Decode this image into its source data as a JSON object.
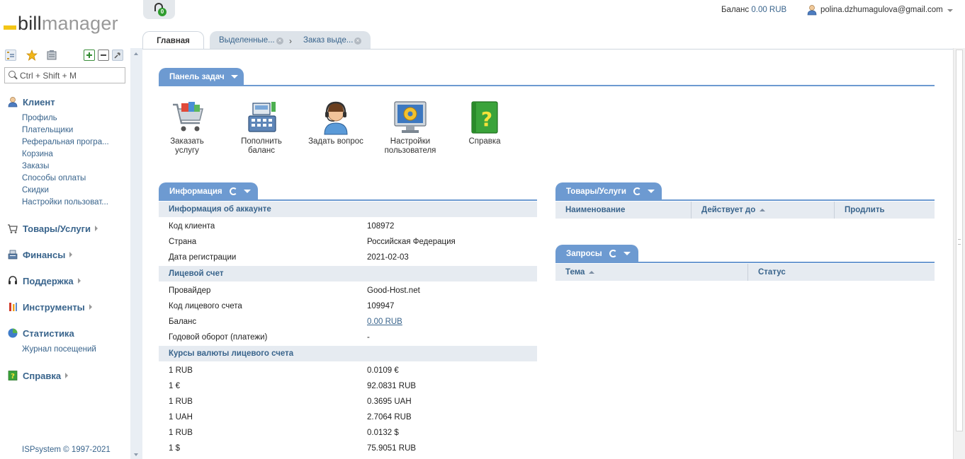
{
  "logo": {
    "part1": "bill",
    "part2": "manager"
  },
  "search": {
    "placeholder": "Ctrl + Shift + M"
  },
  "sidebar": {
    "client": {
      "title": "Клиент",
      "items": [
        "Профиль",
        "Плательщики",
        "Реферальная програ...",
        "Корзина",
        "Заказы",
        "Способы оплаты",
        "Скидки",
        "Настройки пользоват..."
      ]
    },
    "goods": {
      "title": "Товары/Услуги"
    },
    "finance": {
      "title": "Финансы"
    },
    "support": {
      "title": "Поддержка"
    },
    "tools": {
      "title": "Инструменты"
    },
    "stats": {
      "title": "Статистика",
      "items": [
        "Журнал посещений"
      ]
    },
    "help": {
      "title": "Справка"
    },
    "footer": "ISPsystem © 1997-2021"
  },
  "topbar": {
    "support_badge": "0",
    "balance_label": "Баланс",
    "balance_value": "0.00 RUB",
    "user_email": "polina.dzhumagulova@gmail.com"
  },
  "tabs": {
    "main": "Главная",
    "selected": "Выделенные...",
    "order": "Заказ выде..."
  },
  "taskbar": {
    "title": "Панель задач",
    "actions": [
      {
        "label1": "Заказать",
        "label2": "услугу",
        "icon": "cart-icon"
      },
      {
        "label1": "Пополнить",
        "label2": "баланс",
        "icon": "cash-register-icon"
      },
      {
        "label1": "Задать вопрос",
        "label2": "",
        "icon": "support-agent-icon"
      },
      {
        "label1": "Настройки",
        "label2": "пользователя",
        "icon": "settings-monitor-icon"
      },
      {
        "label1": "Справка",
        "label2": "",
        "icon": "help-book-icon"
      }
    ]
  },
  "info": {
    "title": "Информация",
    "account_section": "Информация об аккаунте",
    "client_id_label": "Код клиента",
    "client_id": "108972",
    "country_label": "Страна",
    "country": "Российская Федерация",
    "reg_date_label": "Дата регистрации",
    "reg_date": "2021-02-03",
    "ledger_section": "Лицевой счет",
    "provider_label": "Провайдер",
    "provider": "Good-Host.net",
    "ledger_id_label": "Код лицевого счета",
    "ledger_id": "109947",
    "balance_label": "Баланс",
    "balance": "0.00 RUB",
    "turnover_label": "Годовой оборот (платежи)",
    "turnover": "-",
    "rates_section": "Курсы валюты лицевого счета",
    "rates": [
      {
        "k": "1 RUB",
        "v": "0.0109 €"
      },
      {
        "k": "1 €",
        "v": "92.0831 RUB"
      },
      {
        "k": "1 RUB",
        "v": "0.3695 UAH"
      },
      {
        "k": "1 UAH",
        "v": "2.7064 RUB"
      },
      {
        "k": "1 RUB",
        "v": "0.0132 $"
      },
      {
        "k": "1 $",
        "v": "75.9051 RUB"
      }
    ]
  },
  "goods_panel": {
    "title": "Товары/Услуги",
    "col_name": "Наименование",
    "col_valid": "Действует до",
    "col_renew": "Продлить"
  },
  "requests_panel": {
    "title": "Запросы",
    "col_topic": "Тема",
    "col_status": "Статус"
  }
}
